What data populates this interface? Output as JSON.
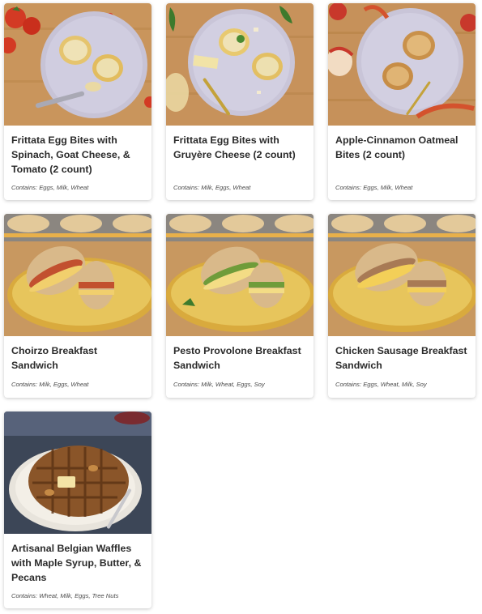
{
  "items": [
    {
      "title": "Frittata Egg Bites with Spinach, Goat Cheese, & Tomato (2 count)",
      "allergens": "Contains: Eggs, Milk, Wheat",
      "photo_icon": "egg-bites-photo"
    },
    {
      "title": "Frittata Egg Bites with Gruyère Cheese (2 count)",
      "allergens": "Contains: Milk, Eggs, Wheat",
      "photo_icon": "egg-bites-photo"
    },
    {
      "title": "Apple-Cinnamon Oatmeal Bites (2 count)",
      "allergens": "Contains: Eggs, Milk, Wheat",
      "photo_icon": "oatmeal-bites-photo"
    },
    {
      "title": "Choirzo Breakfast Sandwich",
      "allergens": "Contains: Milk, Eggs, Wheat",
      "photo_icon": "sandwich-photo"
    },
    {
      "title": "Pesto Provolone Breakfast Sandwich",
      "allergens": "Contains: Milk, Wheat, Eggs, Soy",
      "photo_icon": "sandwich-photo"
    },
    {
      "title": "Chicken Sausage Breakfast Sandwich",
      "allergens": "Contains: Eggs, Wheat, Milk, Soy",
      "photo_icon": "sandwich-photo"
    },
    {
      "title": "Artisanal Belgian Waffles with Maple Syrup, Butter, & Pecans",
      "allergens": "Contains: Wheat, Milk, Eggs, Tree Nuts",
      "photo_icon": "waffles-photo"
    }
  ],
  "colors": {
    "title": "#2b2b2b",
    "allergens": "#4a4a4a",
    "card_shadow": "#cccccc",
    "wood": "#c9955c",
    "plate_lavender": "#c7c3d6",
    "plate_yellow": "#e7c55c"
  }
}
